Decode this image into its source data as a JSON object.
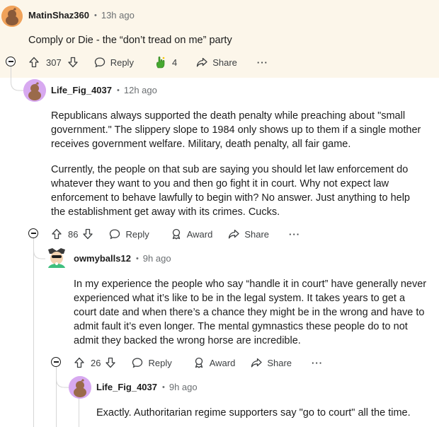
{
  "comments": [
    {
      "username": "MatinShaz360",
      "time": "13h ago",
      "paragraphs": [
        "Comply or Die - the “don’t tread on me” party"
      ],
      "votes": "307",
      "reply_label": "Reply",
      "award_count": "4",
      "share_label": "Share",
      "more_label": "···"
    },
    {
      "username": "Life_Fig_4037",
      "time": "12h ago",
      "paragraphs": [
        "Republicans always supported the death penalty while preaching about \"small government.\" The slippery slope to 1984 only shows up to them if a single mother receives government welfare. Military, death penalty, all fair game.",
        "Currently, the people on that sub are saying you should let law enforcement do whatever they want to you and then go fight it in court. Why not expect law enforcement to behave lawfully to begin with? No answer. Just anything to help the establishment get away with its crimes. Cucks."
      ],
      "votes": "86",
      "reply_label": "Reply",
      "award_label": "Award",
      "share_label": "Share",
      "more_label": "···"
    },
    {
      "username": "owmyballs12",
      "time": "9h ago",
      "paragraphs": [
        "In my experience the people who say “handle it in court” have generally never experienced what it’s like to be in the legal system. It takes years to get a court date and when there’s a chance they might be in the wrong and have to admit fault it’s even longer. The mental gymnastics these people do to not admit they backed the wrong horse are incredible."
      ],
      "votes": "26",
      "reply_label": "Reply",
      "award_label": "Award",
      "share_label": "Share",
      "more_label": "···"
    },
    {
      "username": "Life_Fig_4037",
      "time": "9h ago",
      "paragraphs": [
        "Exactly. Authoritarian regime supporters say \"go to court\" all the time."
      ]
    }
  ],
  "colors": {
    "highlight_bg": "#fcf6ea",
    "snoo_orange": "#f0a25a",
    "snoo_purple": "#d7a9f0",
    "award_green": "#46a82f"
  },
  "icons": [
    "upvote-icon",
    "downvote-icon",
    "reply-icon",
    "award-icon",
    "share-icon",
    "collapse-icon"
  ]
}
